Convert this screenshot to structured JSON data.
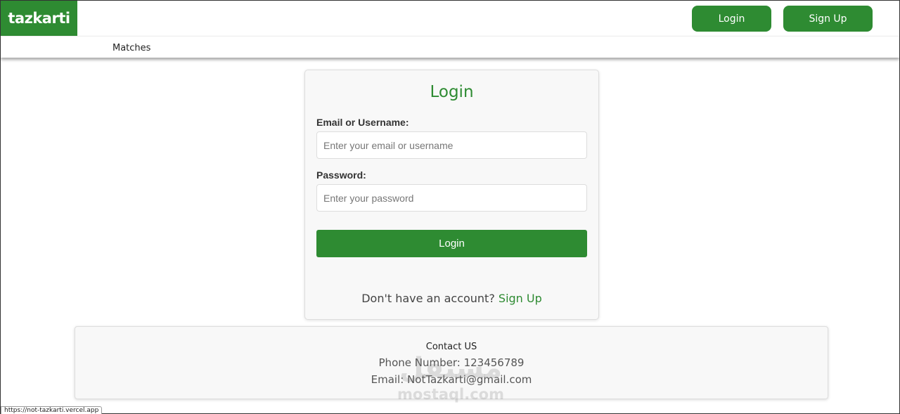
{
  "header": {
    "logo": "tazkarti",
    "login_button": "Login",
    "signup_button": "Sign Up"
  },
  "nav": {
    "matches": "Matches"
  },
  "login_form": {
    "title": "Login",
    "email_label": "Email or Username:",
    "email_placeholder": "Enter your email or username",
    "password_label": "Password:",
    "password_placeholder": "Enter your password",
    "submit_label": "Login",
    "no_account_text": "Don't have an account?",
    "signup_link": "Sign Up"
  },
  "footer": {
    "heading": "Contact US",
    "phone": "Phone Number: 123456789",
    "email": "Email: NotTazkarti@gmail.com"
  },
  "watermark": {
    "text": "mostaql.com"
  },
  "status_bar": {
    "url": "https://not-tazkarti.vercel.app"
  },
  "colors": {
    "brand_green": "#2e8b32",
    "card_bg": "#f8f8f8"
  }
}
